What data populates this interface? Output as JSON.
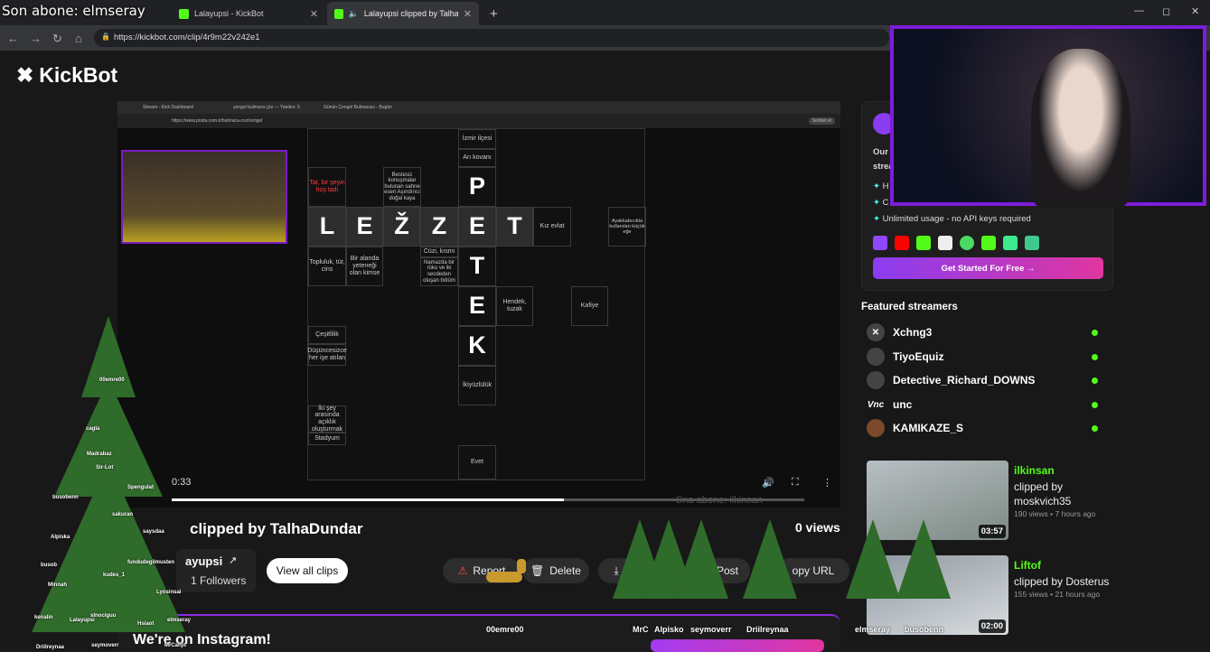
{
  "overlay": {
    "top_text": "Son abone: elmseray"
  },
  "browser": {
    "tabs": [
      {
        "label": "Lalayupsi - KickBot"
      },
      {
        "label": "Lalayupsi clipped by TalhaDur"
      }
    ],
    "url": "https://kickbot.com/clip/4r9m22v242e1",
    "window_controls": [
      "—",
      "◻",
      "✕"
    ]
  },
  "site": {
    "logo_text": "KickBot"
  },
  "video": {
    "inner_tabs": [
      "Stream - Kick Dashboard",
      "çengel bulmaca çöz — Yandex: 5",
      "Günün Çengel Bulmacası - Bugün"
    ],
    "inner_url": "https://www.posta.com.tr/bulmaca-coz/cengel",
    "inner_button": "Sohbet et",
    "time": "0:33",
    "progress": 0.62,
    "watermark": "Sna abone: ilkinsan",
    "puzzle": {
      "word_across": [
        "L",
        "E",
        "Ž",
        "Z",
        "E",
        "T"
      ],
      "word_down": [
        "P",
        "T",
        "E",
        "K"
      ],
      "clues": {
        "c1": "İzmir ilçesi",
        "c2": "Arı kovanı",
        "c3": "Tat, bir şeyin hoş tadı",
        "c4": "Bestesiz konuşmalar bulunan sahne eseri Aşındırıcı doğal kaya",
        "c5": "Kız evlat",
        "c6": "Ayakkabıcıkta kullanılan küçük eğe",
        "c7": "Topluluk, tür, cins",
        "c8": "Bir alanda yeteneği olan kimse",
        "c9": "Cüzi, kısmi",
        "c10": "Namazda bir rüku ve iki secdeden oluşan bölüm",
        "c11": "Hendek, tuzak",
        "c12": "Kafiye",
        "c13": "Çeşitlilik",
        "c14": "Düşüncesizce her işe atılan",
        "c15": "İkiyüzlülük",
        "c16": "İki şey arasında açıklık oluşturmak",
        "c17": "Stadyum",
        "c18": "Evet"
      }
    }
  },
  "clip": {
    "title": "clipped by TalhaDundar",
    "views": "0 views",
    "streamer_name": "ayupsi",
    "followers": "1 Followers",
    "buttons": {
      "view_all": "View all clips",
      "report": "Report",
      "delete": "Delete",
      "post": "Post",
      "copy_url": "opy URL"
    }
  },
  "instagram_banner": {
    "title": "We're on Instagram!"
  },
  "promo": {
    "line1": "Our",
    "line2": "strea",
    "bullet1": "H",
    "bullet2": "C",
    "bullet3": "Unlimited usage - no API keys required",
    "cta": "Get Started For Free →"
  },
  "featured": {
    "title": "Featured streamers",
    "streamers": [
      "Xchng3",
      "TiyoEquiz",
      "Detective_Richard_DOWNS",
      "unc",
      "KAMIKAZE_S"
    ]
  },
  "related_clips": [
    {
      "channel": "ilkinsan",
      "by": "clipped by moskvich35",
      "meta": "190 views • 7 hours ago",
      "duration": "03:57"
    },
    {
      "channel": "Liftof",
      "by": "clipped by Dosterus",
      "meta": "155 views • 21 hours ago",
      "duration": "02:00"
    }
  ],
  "overlay_names": {
    "tree": [
      "00emre00",
      "cagla",
      "Madrabaz",
      "Sir-Lot",
      "Spengulat",
      "busobenn",
      "sakuran",
      "Alpiska",
      "saysdaa",
      "busob",
      "fundudegilmusten",
      "kudes_1",
      "Minnah",
      "Lyosinsai",
      "kenalin",
      "Lalayupsi",
      "Hsiaot",
      "elmseray",
      "slnociguu",
      "Driilreynaa",
      "seymoverr",
      "MrCanjit"
    ],
    "bottom": [
      "00emre00",
      "MrC",
      "Alpisko",
      "seymoverr",
      "Driilreynaa",
      "elmseray",
      "busobenn"
    ]
  }
}
